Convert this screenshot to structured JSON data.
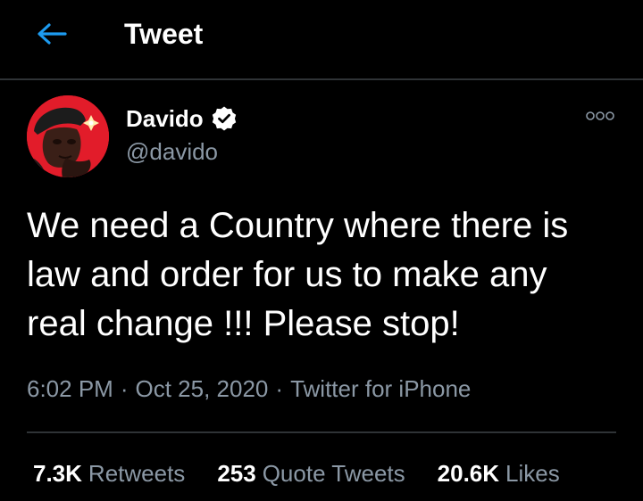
{
  "header": {
    "back_icon": "arrow-left-icon",
    "title": "Tweet",
    "accent_color": "#1d9bf0"
  },
  "tweet": {
    "author": {
      "name": "Davido",
      "handle": "@davido",
      "verified_icon": "verified-badge-icon",
      "avatar_color": "#e21c2a"
    },
    "more_icon": "more-options-icon",
    "text": "We need a Country where there is law and order for us to make any real change !!! Please stop!",
    "time": "6:02 PM",
    "date": "Oct 25, 2020",
    "separator": "·",
    "source": "Twitter for iPhone",
    "stats": {
      "retweets": {
        "value": "7.3K",
        "label": "Retweets"
      },
      "quote_tweets": {
        "value": "253",
        "label": "Quote Tweets"
      },
      "likes": {
        "value": "20.6K",
        "label": "Likes"
      }
    }
  },
  "colors": {
    "background": "#000000",
    "text_primary": "#ffffff",
    "text_secondary": "#8b98a5",
    "divider": "#2f3336"
  }
}
